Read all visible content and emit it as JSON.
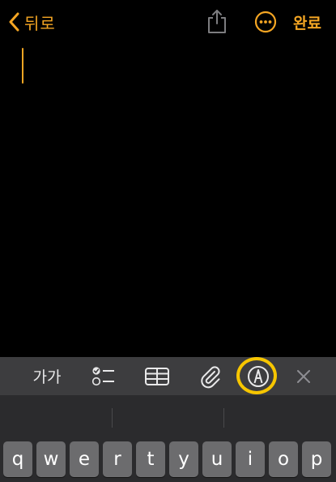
{
  "nav": {
    "back_label": "뒤로",
    "done_label": "완료"
  },
  "toolbar": {
    "format_label": "가가"
  },
  "keyboard": {
    "row1": [
      "q",
      "w",
      "e",
      "r",
      "t",
      "y",
      "u",
      "i",
      "o",
      "p"
    ]
  },
  "colors": {
    "accent": "#f5a623",
    "highlight": "#f7c600",
    "background": "#000000",
    "toolbar": "#3d3d3f",
    "keyboard": "#2b2b2d",
    "key": "#6c6c6e"
  },
  "icons": {
    "back": "chevron-left-icon",
    "share": "share-icon",
    "more": "ellipsis-circle-icon",
    "checklist": "checklist-icon",
    "table": "table-icon",
    "attach": "paperclip-icon",
    "markup": "markup-pen-icon",
    "close": "close-icon"
  }
}
